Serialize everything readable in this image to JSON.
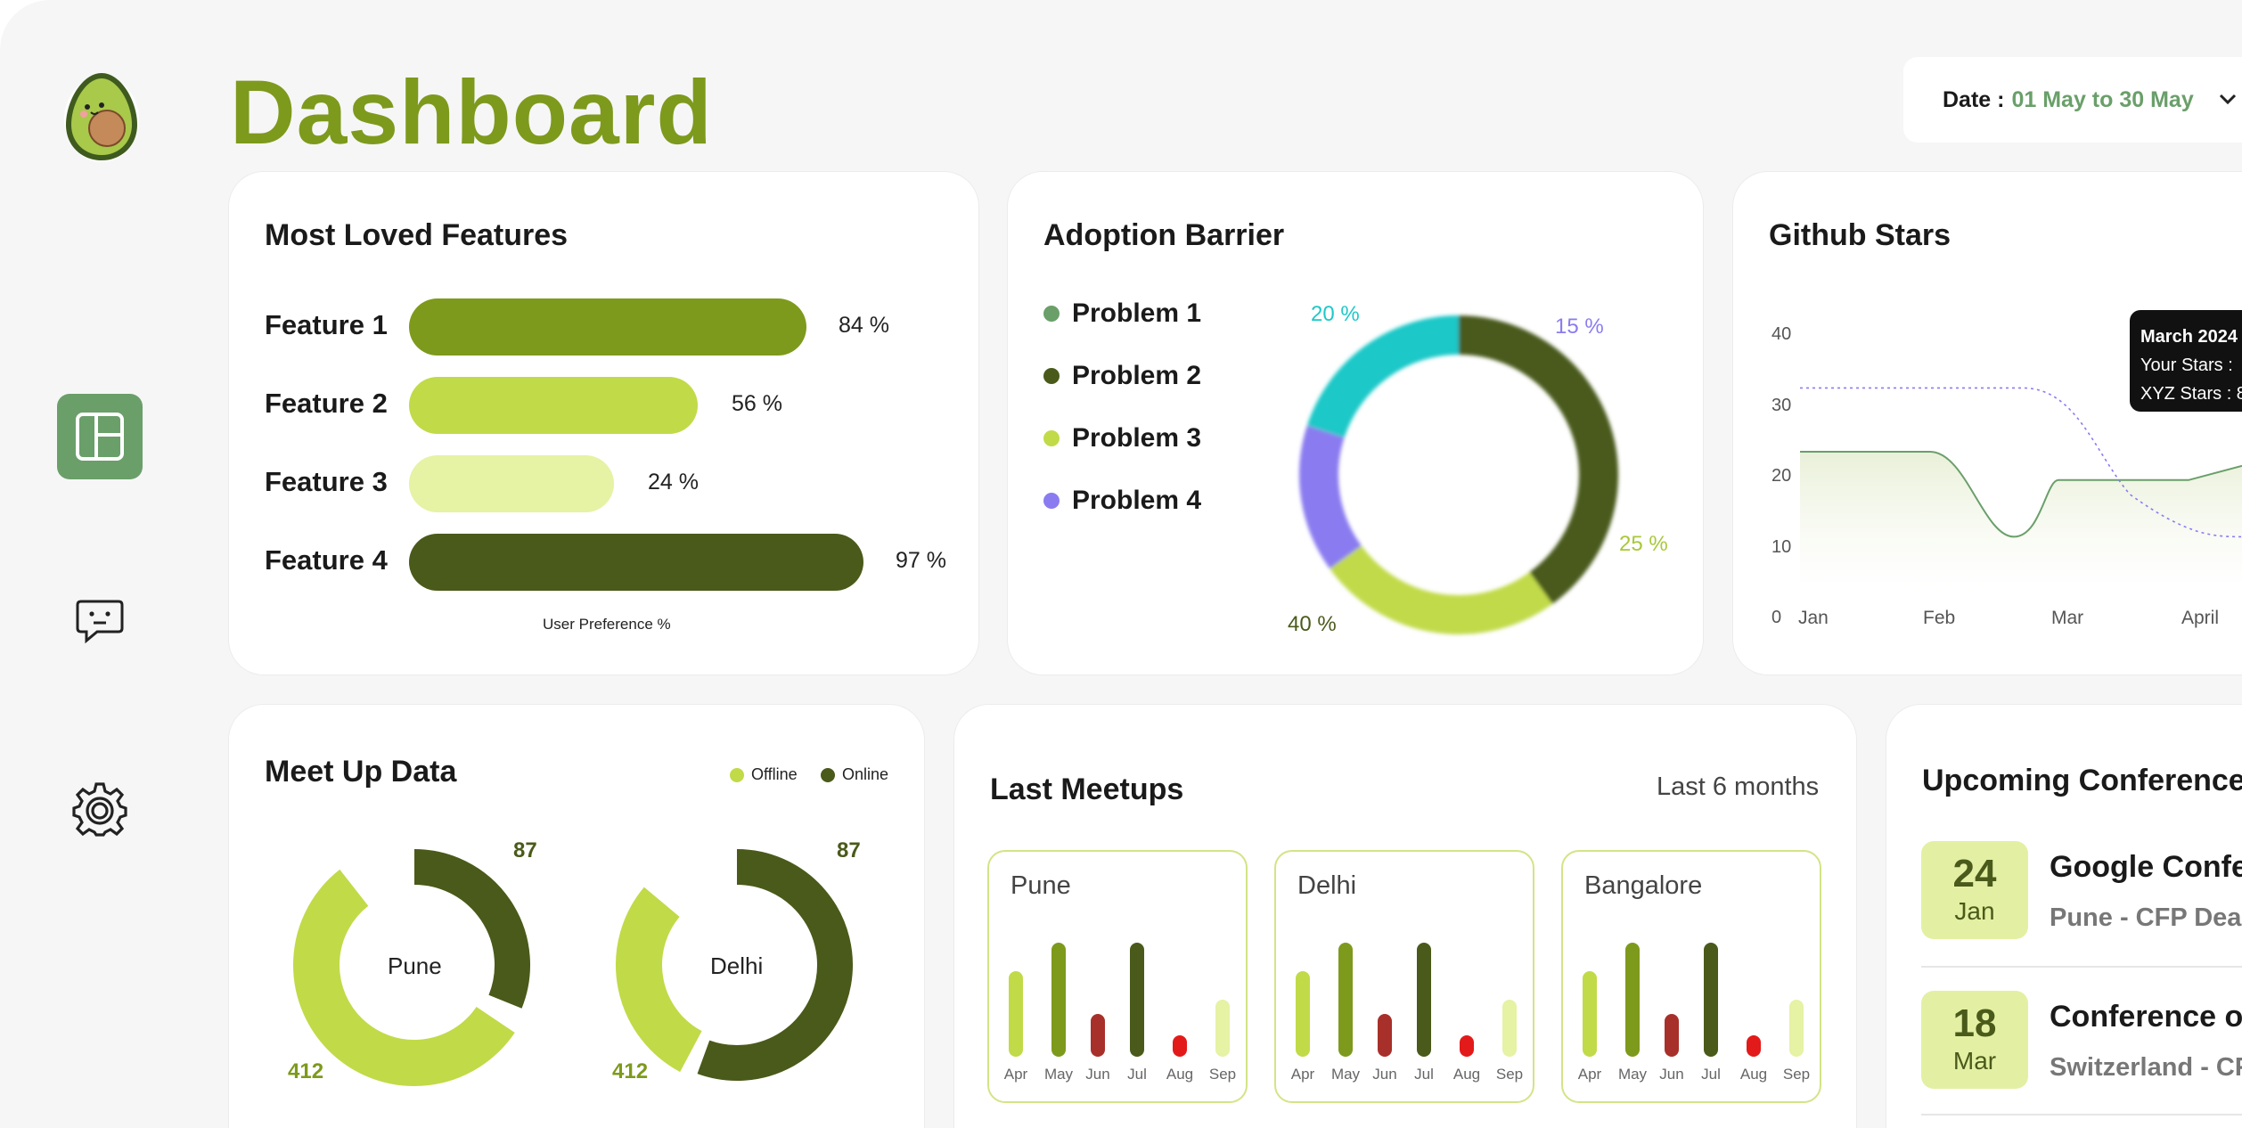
{
  "header": {
    "title": "Dashboard",
    "date_label": "Date :",
    "date_value": "01 May to 30 May"
  },
  "colors": {
    "accent": "#7d9a1c",
    "nav_active": "#6a9f6a",
    "dark_green": "#4a5a1a",
    "lime": "#c1da48",
    "pale_lime": "#e6f2a4",
    "teal": "#1ec8c8",
    "purple": "#8a7cf0",
    "red": "#a8302a"
  },
  "sidebar": {
    "icons": [
      "avocado-logo",
      "dashboard-icon",
      "chat-icon",
      "gear-icon"
    ]
  },
  "features": {
    "title": "Most Loved Features",
    "caption": "User Preference %",
    "items": [
      {
        "label": "Feature 1",
        "value": 84,
        "pct": "84 %",
        "color": "#7d9a1c"
      },
      {
        "label": "Feature 2",
        "value": 56,
        "pct": "56 %",
        "color": "#c1da48"
      },
      {
        "label": "Feature 3",
        "value": 24,
        "pct": "24 %",
        "color": "#e6f2a4"
      },
      {
        "label": "Feature 4",
        "value": 97,
        "pct": "97 %",
        "color": "#4a5a1a"
      }
    ]
  },
  "adoption": {
    "title": "Adoption Barrier",
    "legend": [
      "Problem 1",
      "Problem 2",
      "Problem 3",
      "Problem 4"
    ],
    "labels": {
      "p20": "20 %",
      "p15": "15 %",
      "p25": "25 %",
      "p40": "40 %"
    }
  },
  "github": {
    "title": "Github Stars",
    "y_ticks": [
      "40",
      "30",
      "20",
      "10",
      "0"
    ],
    "x_ticks": [
      "Jan",
      "Feb",
      "Mar",
      "April"
    ],
    "tooltip": {
      "title": "March 2024",
      "line1": "Your Stars :",
      "line2": "XYZ Stars : 8"
    }
  },
  "meetup": {
    "title": "Meet Up Data",
    "legend": [
      "Offline",
      "Online"
    ],
    "cities": [
      {
        "name": "Pune",
        "online": "87",
        "offline": "412"
      },
      {
        "name": "Delhi",
        "online": "87",
        "offline": "412"
      }
    ]
  },
  "last_meetups": {
    "title": "Last Meetups",
    "period": "Last 6 months",
    "months": [
      "Apr",
      "May",
      "Jun",
      "Jul",
      "Aug",
      "Sep"
    ],
    "cities": [
      "Pune",
      "Delhi",
      "Bangalore"
    ]
  },
  "conferences": {
    "title": "Upcoming Conferences",
    "items": [
      {
        "day": "24",
        "month": "Jan",
        "name": "Google Confe",
        "sub": "Pune - CFP Dead"
      },
      {
        "day": "18",
        "month": "Mar",
        "name": "Conference o",
        "sub": "Switzerland - CF"
      }
    ]
  },
  "chart_data": [
    {
      "type": "bar",
      "title": "Most Loved Features",
      "categories": [
        "Feature 1",
        "Feature 2",
        "Feature 3",
        "Feature 4"
      ],
      "values": [
        84,
        56,
        24,
        97
      ],
      "xlabel": "User Preference %"
    },
    {
      "type": "pie",
      "title": "Adoption Barrier",
      "categories": [
        "Problem 1",
        "Problem 2",
        "Problem 3",
        "Problem 4"
      ],
      "values": [
        20,
        40,
        25,
        15
      ]
    },
    {
      "type": "line",
      "title": "Github Stars",
      "categories": [
        "Jan",
        "Feb",
        "Mar",
        "April"
      ],
      "ylim": [
        0,
        40
      ],
      "series": [
        {
          "values": [
            20,
            20,
            16,
            16
          ]
        },
        {
          "values": [
            29,
            29,
            29,
            8
          ]
        }
      ]
    },
    {
      "type": "pie",
      "title": "Meet Up Data",
      "series": [
        {
          "name": "Pune",
          "categories": [
            "Offline",
            "Online"
          ],
          "values": [
            412,
            87
          ]
        },
        {
          "name": "Delhi",
          "categories": [
            "Offline",
            "Online"
          ],
          "values": [
            412,
            87
          ]
        }
      ]
    },
    {
      "type": "bar",
      "title": "Last Meetups",
      "categories": [
        "Apr",
        "May",
        "Jun",
        "Jul",
        "Aug",
        "Sep"
      ],
      "series": [
        {
          "name": "Pune",
          "values": [
            6,
            8,
            3,
            8,
            1.5,
            4
          ]
        },
        {
          "name": "Delhi",
          "values": [
            6,
            8,
            3,
            8,
            1.5,
            4
          ]
        },
        {
          "name": "Bangalore",
          "values": [
            6,
            8,
            3,
            8,
            1.5,
            4
          ]
        }
      ]
    }
  ]
}
